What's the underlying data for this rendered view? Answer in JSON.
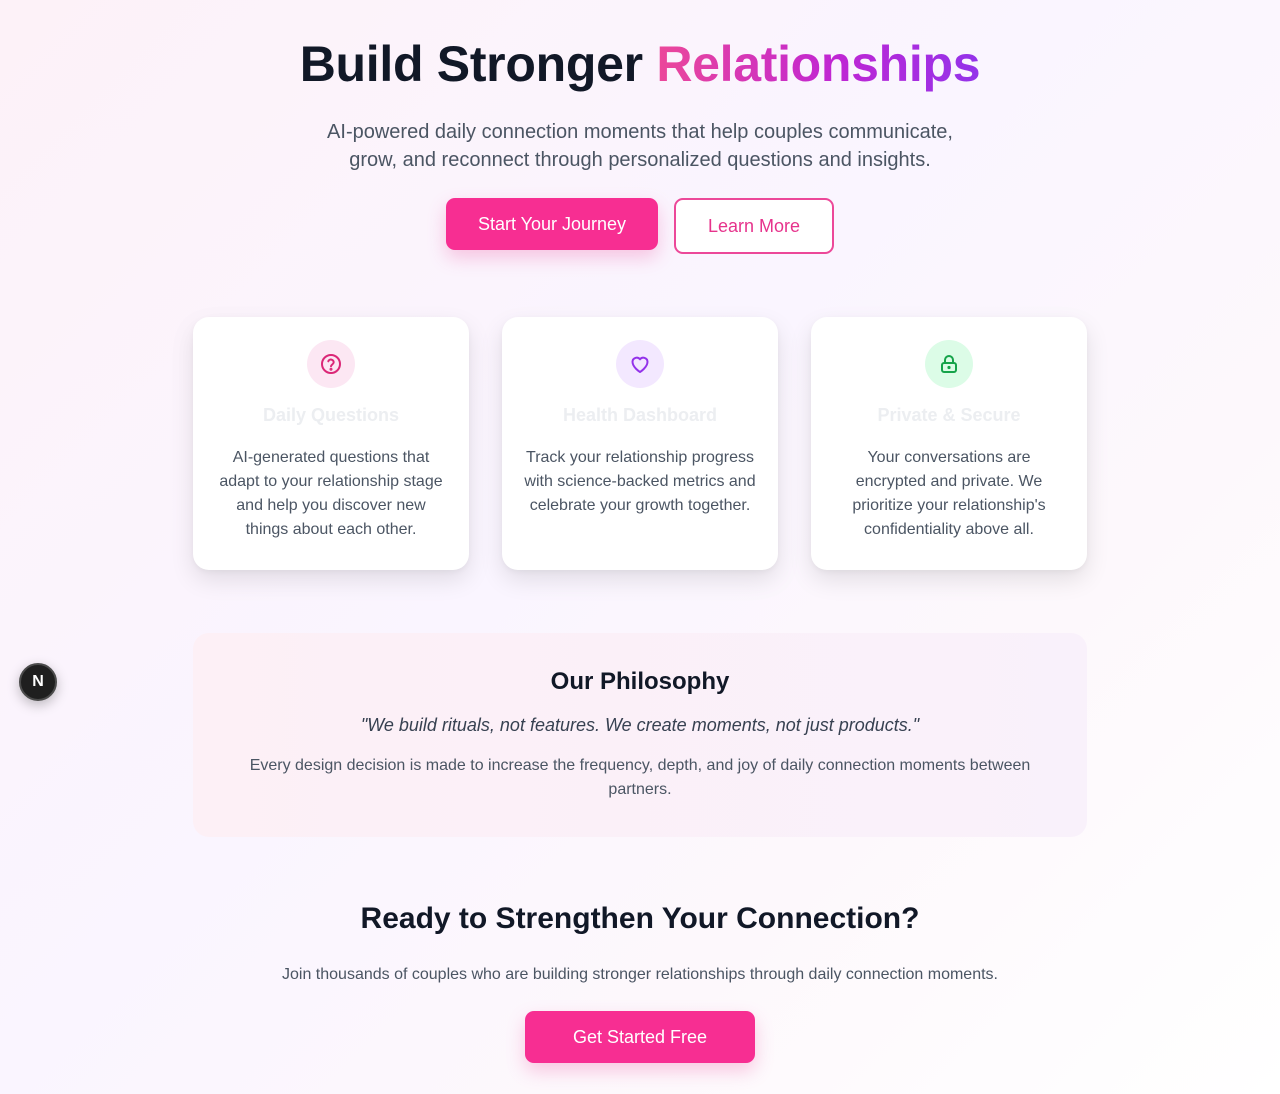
{
  "hero": {
    "title_main": "Build Stronger ",
    "title_accent": "Relationships",
    "subtitle": "AI-powered daily connection moments that help couples communicate, grow, and reconnect through personalized questions and insights.",
    "primary_cta": "Start Your Journey",
    "secondary_cta": "Learn More"
  },
  "features": [
    {
      "icon": "question-circle-icon",
      "icon_color": "#db2777",
      "icon_bg": "#fce7f3",
      "title": "Daily Questions",
      "description": "AI-generated questions that adapt to your relationship stage and help you discover new things about each other."
    },
    {
      "icon": "heart-icon",
      "icon_color": "#9333ea",
      "icon_bg": "#f3e8ff",
      "title": "Health Dashboard",
      "description": "Track your relationship progress with science-backed metrics and celebrate your growth together."
    },
    {
      "icon": "lock-icon",
      "icon_color": "#16a34a",
      "icon_bg": "#dcfce7",
      "title": "Private & Secure",
      "description": "Your conversations are encrypted and private. We prioritize your relationship's confidentiality above all."
    }
  ],
  "philosophy": {
    "title": "Our Philosophy",
    "quote": "\"We build rituals, not features. We create moments, not just products.\"",
    "description": "Every design decision is made to increase the frequency, depth, and joy of daily connection moments between partners."
  },
  "cta": {
    "title": "Ready to Strengthen Your Connection?",
    "subtitle": "Join thousands of couples who are building stronger relationships through daily connection moments.",
    "button": "Get Started Free"
  },
  "dev_badge": {
    "label": "N"
  },
  "colors": {
    "primary": "#f72e92",
    "accent_gradient_start": "#ec4899",
    "accent_gradient_end": "#9333ea"
  }
}
